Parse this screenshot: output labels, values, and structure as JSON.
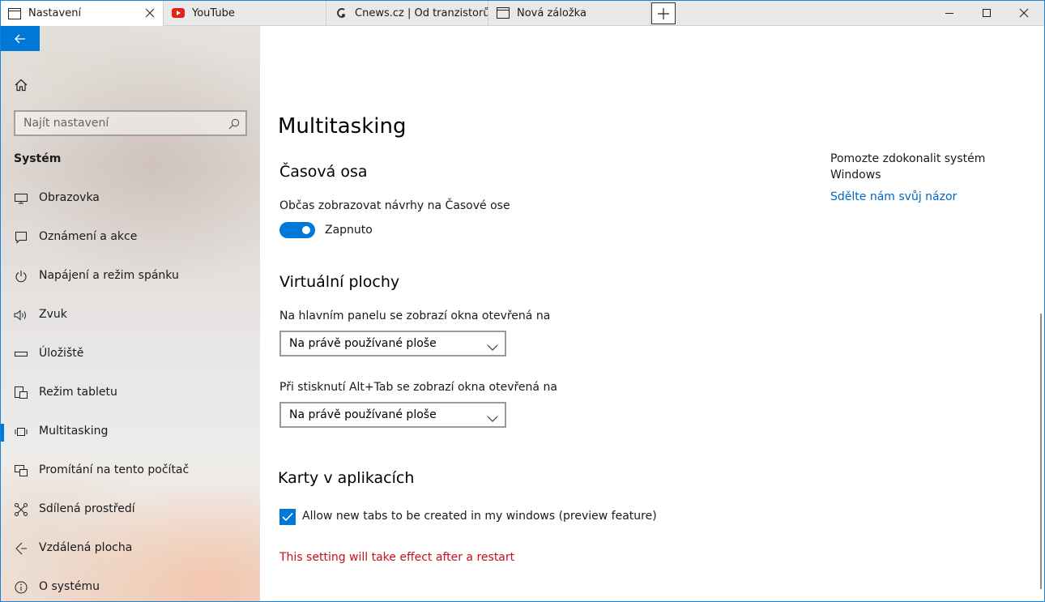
{
  "tabs": [
    {
      "label": "Nastavení",
      "icon": "window-icon",
      "active": true
    },
    {
      "label": "YouTube",
      "icon": "youtube-icon",
      "active": false
    },
    {
      "label": "Cnews.cz | Od tranzistorů až",
      "icon": "cnews-icon",
      "active": false
    },
    {
      "label": "Nová záložka",
      "icon": "window-icon",
      "active": false
    }
  ],
  "window_controls": {
    "new_tab": "+",
    "minimize": "minimize",
    "maximize": "maximize",
    "close": "close"
  },
  "sidebar": {
    "search_placeholder": "Najít nastavení",
    "section": "Systém",
    "items": [
      {
        "label": "Obrazovka",
        "icon": "monitor-icon"
      },
      {
        "label": "Oznámení a akce",
        "icon": "notification-icon"
      },
      {
        "label": "Napájení a režim spánku",
        "icon": "power-icon"
      },
      {
        "label": "Zvuk",
        "icon": "speaker-icon"
      },
      {
        "label": "Úložiště",
        "icon": "storage-icon"
      },
      {
        "label": "Režim tabletu",
        "icon": "tablet-icon"
      },
      {
        "label": "Multitasking",
        "icon": "multitasking-icon",
        "selected": true
      },
      {
        "label": "Promítání na tento počítač",
        "icon": "projection-icon"
      },
      {
        "label": "Sdílená prostředí",
        "icon": "shared-icon"
      },
      {
        "label": "Vzdálená plocha",
        "icon": "remote-icon"
      },
      {
        "label": "O systému",
        "icon": "info-icon"
      }
    ]
  },
  "main": {
    "title": "Multitasking",
    "timeline": {
      "heading": "Časová osa",
      "label": "Občas zobrazovat návrhy na Časové ose",
      "toggle_state": "Zapnuto"
    },
    "virtual_desktops": {
      "heading": "Virtuální plochy",
      "taskbar_label": "Na hlavním panelu se zobrazí okna otevřená na",
      "taskbar_value": "Na právě používané ploše",
      "alttab_label": "Při stisknutí Alt+Tab se zobrazí okna otevřená na",
      "alttab_value": "Na právě používané ploše"
    },
    "app_tabs": {
      "heading": "Karty v aplikacích",
      "checkbox_label": "Allow new tabs to be created in my windows (preview feature)",
      "checked": true,
      "warning": "This setting will take effect after a restart"
    }
  },
  "help": {
    "text": "Pomozte zdokonalit systém Windows",
    "link": "Sdělte nám svůj názor"
  },
  "colors": {
    "accent": "#0078d7",
    "link": "#0067c0",
    "warning": "#c50f1f"
  }
}
